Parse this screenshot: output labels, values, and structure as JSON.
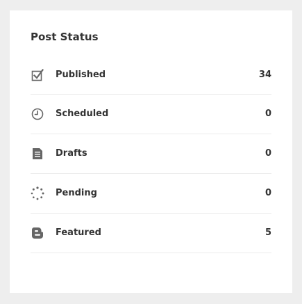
{
  "widget": {
    "title": "Post Status",
    "rows": [
      {
        "label": "Published",
        "count": "34",
        "icon": "checkbox-checked-icon"
      },
      {
        "label": "Scheduled",
        "count": "0",
        "icon": "clock-icon"
      },
      {
        "label": "Drafts",
        "count": "0",
        "icon": "document-icon"
      },
      {
        "label": "Pending",
        "count": "0",
        "icon": "spinner-icon"
      },
      {
        "label": "Featured",
        "count": "5",
        "icon": "blogger-icon"
      }
    ]
  },
  "colors": {
    "background": "#eeeeee",
    "card": "#ffffff",
    "text": "#333333",
    "icon": "#666666",
    "divider": "#ebebeb"
  }
}
